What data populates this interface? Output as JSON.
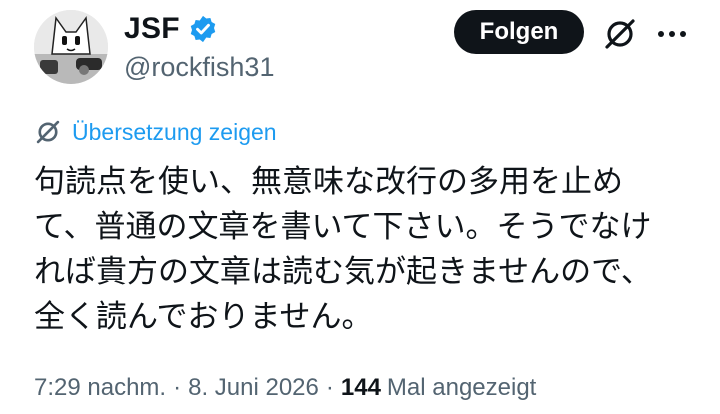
{
  "author": {
    "display_name": "JSF",
    "handle": "@rockfish31",
    "verified": true,
    "verified_color": "#1d9bf0"
  },
  "actions": {
    "follow_label": "Folgen",
    "grok_icon": "grok-icon",
    "more_icon": "more-icon"
  },
  "translate": {
    "label": "Übersetzung zeigen",
    "icon": "grok-icon"
  },
  "tweet": {
    "lines": [
      "句読点を使い、無意味な改行の多用を止め",
      "て、普通の文章を書いて下さい。そうでなけ",
      "れば貴方の文章は読む気が起きませんので、",
      "全く読んでおりません。"
    ]
  },
  "meta": {
    "time": "7:29 nachm.",
    "separator": "·",
    "date": "8. Juni 2026",
    "views_count": "144",
    "views_label": "Mal angezeigt"
  },
  "colors": {
    "accent": "#1d9bf0",
    "text": "#0f1419",
    "secondary": "#536471",
    "button_bg": "#0f1419"
  }
}
